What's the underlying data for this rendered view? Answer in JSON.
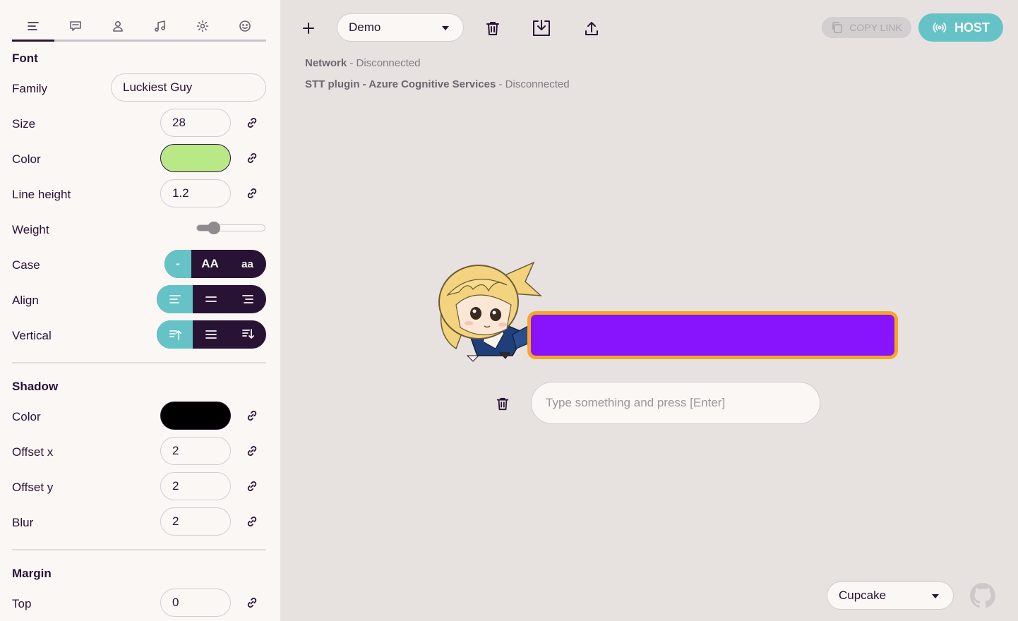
{
  "sidebar": {
    "tabs": [
      {
        "icon": "text-align-icon",
        "active": true
      },
      {
        "icon": "chat-icon",
        "active": false
      },
      {
        "icon": "user-icon",
        "active": false
      },
      {
        "icon": "music-icon",
        "active": false
      },
      {
        "icon": "gear-icon",
        "active": false
      },
      {
        "icon": "smile-icon",
        "active": false
      }
    ],
    "font": {
      "title": "Font",
      "family_label": "Family",
      "family_value": "Luckiest Guy",
      "size_label": "Size",
      "size_value": "28",
      "color_label": "Color",
      "color_value": "#b8e986",
      "line_height_label": "Line height",
      "line_height_value": "1.2",
      "weight_label": "Weight",
      "weight_level": 0.25,
      "case_label": "Case",
      "case_options": [
        "-",
        "AA",
        "aa"
      ],
      "case_selected": 0,
      "align_label": "Align",
      "align_options": [
        "align-left-icon",
        "align-center-icon",
        "align-right-icon"
      ],
      "align_selected": 0,
      "vertical_label": "Vertical",
      "vertical_options": [
        "align-top-icon",
        "align-middle-icon",
        "align-bottom-icon"
      ],
      "vertical_selected": 0
    },
    "shadow": {
      "title": "Shadow",
      "color_label": "Color",
      "color_value": "#000000",
      "offset_x_label": "Offset x",
      "offset_x_value": "2",
      "offset_y_label": "Offset y",
      "offset_y_value": "2",
      "blur_label": "Blur",
      "blur_value": "2"
    },
    "margin": {
      "title": "Margin",
      "top_label": "Top",
      "top_value": "0"
    }
  },
  "toolbar": {
    "add_icon": "plus-icon",
    "preset_value": "Demo",
    "delete_icon": "trash-icon",
    "import_icon": "download-tray-icon",
    "export_icon": "upload-icon",
    "copy_link_label": "COPY LINK",
    "host_label": "HOST"
  },
  "status": {
    "network_label": "Network",
    "network_state": "Disconnected",
    "stt_label": "STT plugin - Azure Cognitive Services",
    "stt_state": "Disconnected"
  },
  "preview": {
    "bubble_color": "#8714fd",
    "bubble_border": "#f5a623"
  },
  "input": {
    "placeholder": "Type something and press [Enter]"
  },
  "footer": {
    "theme_value": "Cupcake",
    "github_icon": "github-icon"
  },
  "colors": {
    "accent": "#65c3c8",
    "dark": "#291334",
    "background": "#e7e2e0",
    "panel": "#faf7f5"
  }
}
